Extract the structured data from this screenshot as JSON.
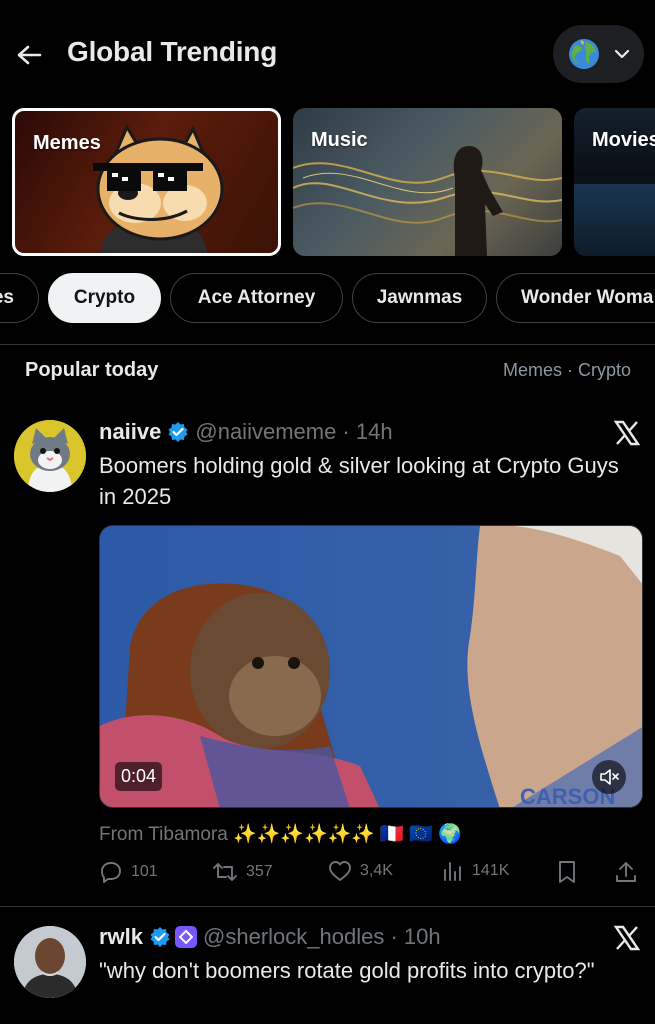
{
  "header": {
    "title": "Global Trending",
    "region_icon": "globe-emoji"
  },
  "categories": [
    {
      "label": "Memes",
      "selected": true
    },
    {
      "label": "Music",
      "selected": false
    },
    {
      "label": "Movies",
      "selected": false
    }
  ],
  "chips": [
    {
      "label": "es"
    },
    {
      "label": "Crypto",
      "active": true
    },
    {
      "label": "Ace Attorney"
    },
    {
      "label": "Jawnmas"
    },
    {
      "label": "Wonder Woma"
    }
  ],
  "section": {
    "title": "Popular today",
    "meta": "Memes · Crypto"
  },
  "posts": [
    {
      "name": "naiive",
      "handle": "@naiivememe · 14h",
      "text": "Boomers holding gold & silver looking at Crypto Guys in 2025",
      "video_time": "0:04",
      "watermark": "CARSON",
      "source": "From Tibamora ✨✨✨✨✨✨ 🇫🇷 🇪🇺 🌍",
      "replies": "101",
      "reposts": "357",
      "likes": "3,4K",
      "views": "141K"
    },
    {
      "name": "rwlk",
      "handle": "@sherlock_hodles · 10h",
      "text": "\"why don't boomers rotate gold profits into crypto?\""
    }
  ],
  "colors": {
    "background": "#000000",
    "text": "#e7e9ea",
    "muted": "#71767b",
    "verified": "#1d9bf0",
    "border": "#2f3336"
  }
}
